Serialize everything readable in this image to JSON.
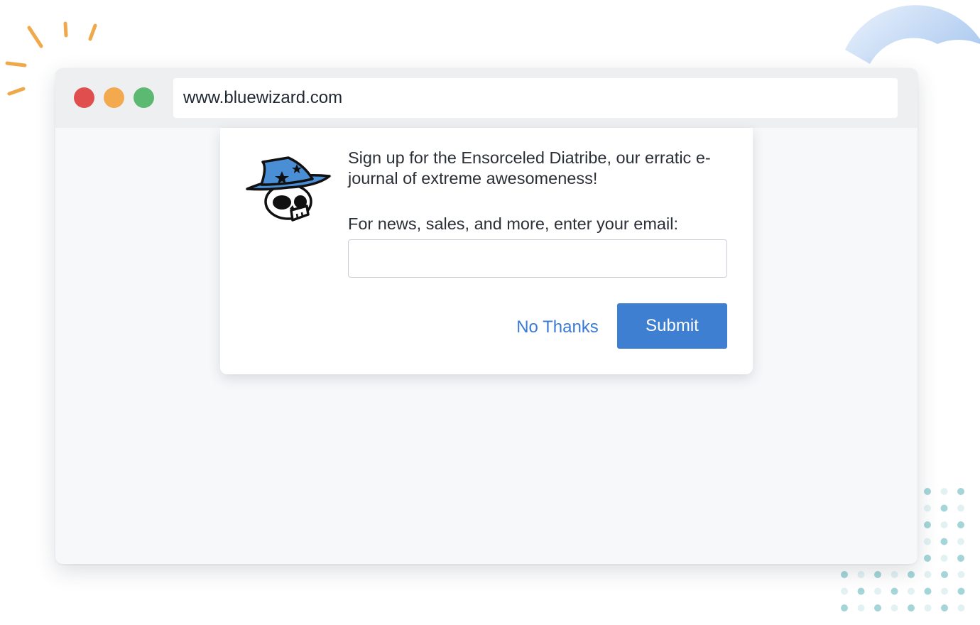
{
  "browser": {
    "url": "www.bluewizard.com",
    "traffic_lights": {
      "close": "#e04e4e",
      "minimize": "#f3a94d",
      "maximize": "#5cb971"
    }
  },
  "popup": {
    "logo_icon": "wizard-skull-icon",
    "headline": "Sign up for the Ensorceled Diatribe, our erratic e-journal of extreme awesomeness!",
    "prompt": "For news, sales, and more, enter your email:",
    "email_value": "",
    "no_thanks_label": "No Thanks",
    "submit_label": "Submit"
  },
  "colors": {
    "accent": "#3f7fd1",
    "link": "#3a7bd5",
    "ray_accent": "#f0a94a",
    "dot_accent": "#9fd3d6"
  }
}
